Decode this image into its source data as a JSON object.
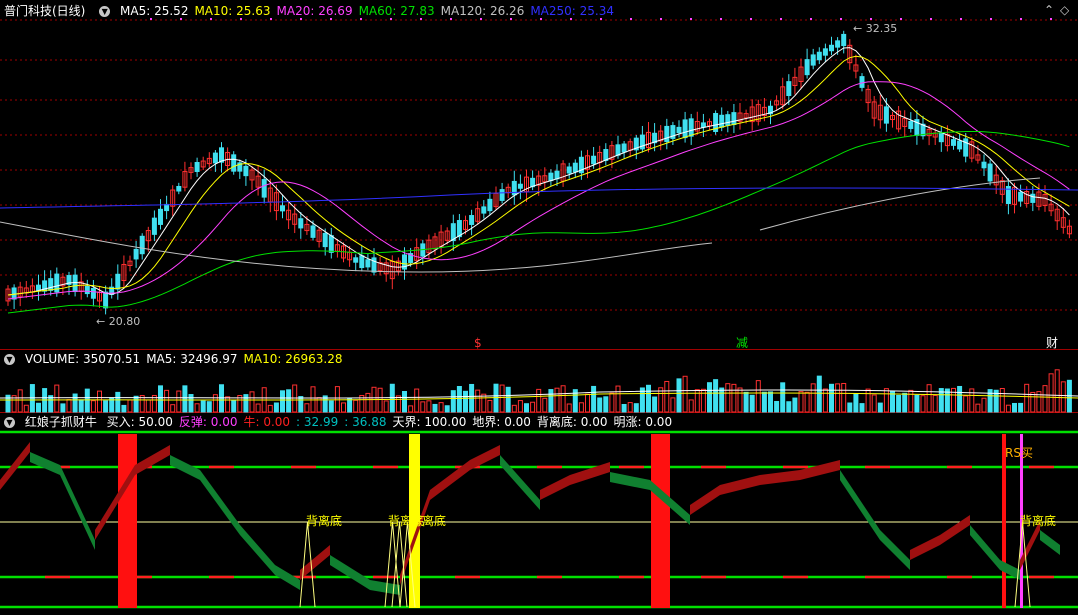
{
  "title": "普门科技(日线)",
  "main_ma": [
    {
      "label": "MA5:",
      "value": "25.52",
      "color": "#ffffff"
    },
    {
      "label": "MA10:",
      "value": "25.63",
      "color": "#ffff00"
    },
    {
      "label": "MA20:",
      "value": "26.69",
      "color": "#ff40ff"
    },
    {
      "label": "MA60:",
      "value": "27.83",
      "color": "#00e000"
    },
    {
      "label": "MA120:",
      "value": "26.26",
      "color": "#c0c0c0"
    },
    {
      "label": "MA250:",
      "value": "25.34",
      "color": "#3030ff"
    }
  ],
  "price_high": "32.35",
  "price_low": "20.80",
  "markers": [
    "$",
    "减",
    "财"
  ],
  "vol": [
    {
      "label": "VOLUME:",
      "value": "35070.51",
      "color": "#ffffff"
    },
    {
      "label": "MA5:",
      "value": "32496.97",
      "color": "#ffffff"
    },
    {
      "label": "MA10:",
      "value": "26963.28",
      "color": "#ffff00"
    }
  ],
  "ind_name": "红娘子抓财牛",
  "ind": [
    {
      "label": "买入:",
      "value": "50.00",
      "color": "#ffffff"
    },
    {
      "label": "反弹:",
      "value": "0.00",
      "color": "#ff40ff"
    },
    {
      "label": "牛:",
      "value": "0.00",
      "color": "#ff2020"
    },
    {
      "label": ":",
      "value": "32.99",
      "color": "#00c0c0"
    },
    {
      "label": ":",
      "value": "36.88",
      "color": "#00c0c0"
    },
    {
      "label": "天界:",
      "value": "100.00",
      "color": "#ffffff"
    },
    {
      "label": "地界:",
      "value": "0.00",
      "color": "#ffffff"
    },
    {
      "label": "背离底:",
      "value": "0.00",
      "color": "#ffffff"
    },
    {
      "label": "明涨:",
      "value": "0.00",
      "color": "#ffffff"
    }
  ],
  "signal_texts": [
    "背离底",
    "背离底",
    "背离底",
    "背离底"
  ],
  "rs_text": "RS买",
  "colors": {
    "up": "#ff3030",
    "down": "#40e0f0",
    "grid": "#a00000"
  }
}
